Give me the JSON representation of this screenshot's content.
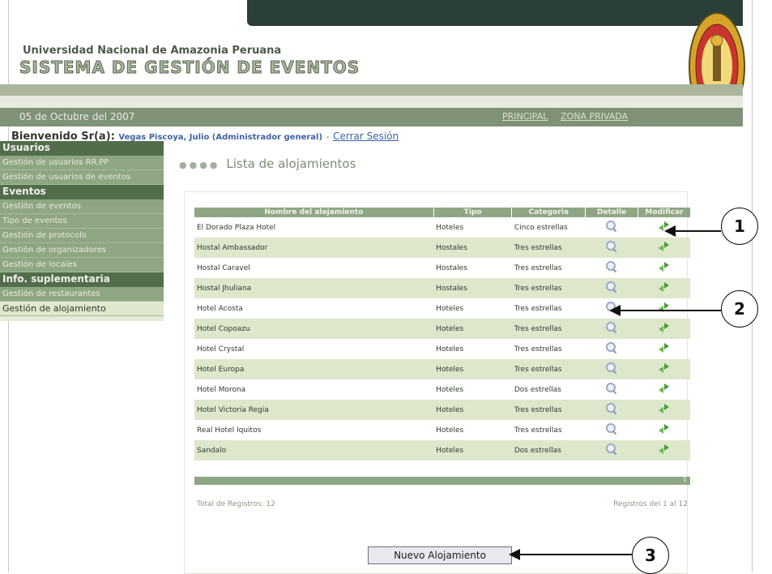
{
  "header": {
    "university": "Universidad Nacional de Amazonia Peruana",
    "system_name": "SISTEMA DE GESTIÓN DE EVENTOS",
    "date": "05 de Octubre del 2007",
    "links": [
      "PRINCIPAL",
      "ZONA PRIVADA"
    ]
  },
  "welcome": {
    "prefix": "Bienvenido Sr(a):",
    "user": "Vegas Piscoya, Julio (Administrador general)",
    "separator": "-",
    "logout": "Cerrar Sesión"
  },
  "sidebar": {
    "sections": [
      {
        "title": "Usuarios",
        "items": [
          "Gestión de usuarios RR.PP",
          "Gestión de usuarios de eventos"
        ]
      },
      {
        "title": "Eventos",
        "items": [
          "Gestión de eventos",
          "Tipo de eventos",
          "Gestión de protocolo",
          "Gestión de organizadores",
          "Gestión de locales"
        ]
      },
      {
        "title": "Info. suplementaria",
        "items": [
          "Gestión de restaurantes",
          "Gestión de alojamiento"
        ]
      }
    ]
  },
  "page": {
    "title": "Lista de alojamientos",
    "columns": [
      "Nombre del alojamiento",
      "Tipo",
      "Categoria",
      "Detalle",
      "Modificar"
    ],
    "rows": [
      [
        "El Dorado Plaza Hotel",
        "Hoteles",
        "Cinco estrellas"
      ],
      [
        "Hostal Ambassador",
        "Hostales",
        "Tres estrellas"
      ],
      [
        "Hostal Caravel",
        "Hostales",
        "Tres estrellas"
      ],
      [
        "Hostal Jhuliana",
        "Hostales",
        "Tres estrellas"
      ],
      [
        "Hotel Acosta",
        "Hoteles",
        "Tres estrellas"
      ],
      [
        "Hotel Copoazu",
        "Hoteles",
        "Tres estrellas"
      ],
      [
        "Hotel Crystal",
        "Hoteles",
        "Tres estrellas"
      ],
      [
        "Hotel Europa",
        "Hoteles",
        "Tres estrellas"
      ],
      [
        "Hotel Morona",
        "Hoteles",
        "Dos estrellas"
      ],
      [
        "Hotel Victoria Regia",
        "Hoteles",
        "Tres estrellas"
      ],
      [
        "Real Hotel Iquitos",
        "Hoteles",
        "Tres estrellas"
      ],
      [
        "Sandalo",
        "Hoteles",
        "Dos estrellas"
      ]
    ],
    "page_indicator": "1",
    "total": "Total de Registros: 12",
    "range": "Registros del 1 al 12",
    "new_button": "Nuevo Alojamiento"
  },
  "callouts": [
    "1",
    "2",
    "3"
  ],
  "icons": {
    "detail": "magnifier-icon",
    "modify": "green-arrows-icon"
  },
  "colors": {
    "sidebar_header": "#536d4c",
    "sidebar_item": "#8fa685",
    "table_header": "#8fa685",
    "alt_row": "#dde7cc",
    "topbar": "#2b3f3a"
  }
}
